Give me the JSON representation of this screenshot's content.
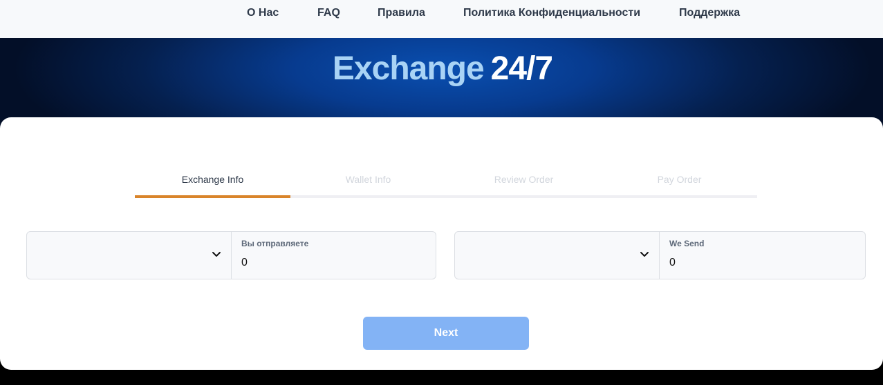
{
  "nav": {
    "items": [
      {
        "label": "О Нас"
      },
      {
        "label": "FAQ"
      },
      {
        "label": "Правила"
      },
      {
        "label": "Политика Конфиденциальности"
      },
      {
        "label": "Поддержка"
      }
    ]
  },
  "hero": {
    "title_part1": "Exchange",
    "title_part2": "24/7"
  },
  "steps": {
    "items": [
      {
        "label": "Exchange Info",
        "active": true
      },
      {
        "label": "Wallet Info",
        "active": false
      },
      {
        "label": "Review Order",
        "active": false
      },
      {
        "label": "Pay Order",
        "active": false
      }
    ],
    "progress_step": 1,
    "progress_total": 4
  },
  "exchange": {
    "send": {
      "currency_selected": "",
      "amount_label": "Вы отправляете",
      "amount_value": "0"
    },
    "receive": {
      "currency_selected": "",
      "amount_label": "We Send",
      "amount_value": "0"
    }
  },
  "next_button": {
    "label": "Next"
  },
  "colors": {
    "accent_orange": "#d9842a",
    "button_blue": "#83b3f5",
    "hero_light_blue": "#a9d3f5",
    "hero_dark": "#030f28"
  },
  "icons": {
    "select_chevron": "chevron-down-icon"
  }
}
